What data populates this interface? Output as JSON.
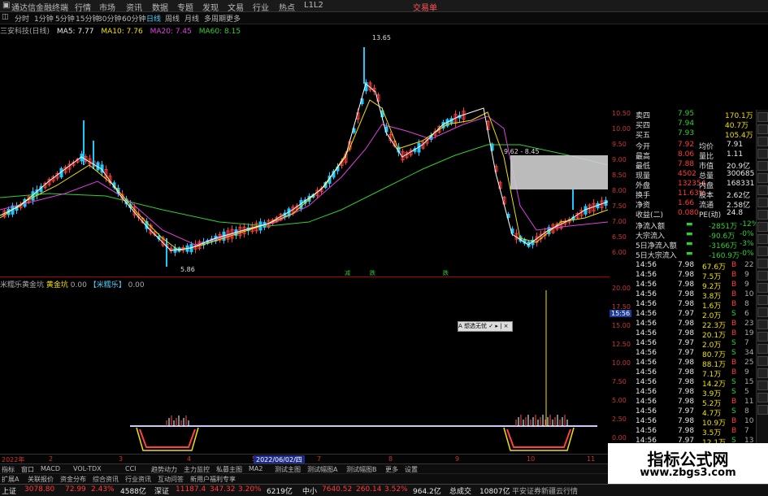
{
  "titlebar": {
    "app_title": "通达信金融终端",
    "menu": [
      "行情",
      "市场",
      "资讯",
      "数据",
      "专题",
      "发现",
      "文易",
      "行业",
      "热点",
      "L1L2"
    ],
    "right_label": "交易单"
  },
  "periodbar": {
    "items": [
      "分时",
      "1分钟",
      "5分钟",
      "15分钟",
      "30分钟",
      "60分钟",
      "日线",
      "周线",
      "月线",
      "多周期",
      "更多"
    ],
    "active": "日线"
  },
  "ma_legend": {
    "stock": "三安科技(日线)",
    "ma5": "MA5: 7.77",
    "ma10": "MA10: 7.76",
    "ma20": "MA20: 7.45",
    "ma60": "MA60: 8.15"
  },
  "colors": {
    "up": "#ff3b3b",
    "down": "#1ec8ff",
    "ma5": "#ffffff",
    "ma10": "#f0e000",
    "ma20": "#e040e0",
    "ma60": "#2fd02f",
    "grid_red": "#a00000"
  },
  "main_annotations": {
    "high": "13.65",
    "low": "5.86",
    "mid_label": "9.62 - 8.45"
  },
  "signal_marks": [
    "减",
    "跌",
    "跌"
  ],
  "indicator_legend": {
    "name": "米糯乐黄金坑",
    "label1": "黄金坑",
    "val1": "0.00",
    "label2": "【米糯乐】",
    "val2": "0.00"
  },
  "right_axis": {
    "price_ticks": [
      "10.50",
      "10.00",
      "9.50",
      "9.00",
      "8.50",
      "8.00",
      "7.50",
      "7.00",
      "6.50",
      "6.00"
    ],
    "ind_ticks": [
      "20.00",
      "17.50",
      "15.00",
      "12.50",
      "10.00",
      "7.50",
      "5.00",
      "2.50",
      "0.00"
    ],
    "time_label": "15:56"
  },
  "quote": {
    "top": [
      {
        "label": "卖四",
        "price": "7.95",
        "vol": "170.1万"
      },
      {
        "label": "买四",
        "price": "7.94",
        "vol": "40.7万"
      },
      {
        "label": "买五",
        "price": "7.93",
        "vol": "105.4万"
      }
    ],
    "stats": [
      {
        "l1": "今开",
        "v1": "7.92",
        "l2": "均价",
        "v2": "7.91"
      },
      {
        "l1": "最高",
        "v1": "8.06",
        "l2": "量比",
        "v2": "1.11"
      },
      {
        "l1": "最低",
        "v1": "7.88",
        "l2": "市值",
        "v2": "20.9亿"
      },
      {
        "l1": "现量",
        "v1": "4502",
        "l2": "总量",
        "v2": "300685"
      },
      {
        "l1": "外盘",
        "v1": "132354",
        "l2": "内盘",
        "v2": "168331"
      },
      {
        "l1": "换手",
        "v1": "11.63%",
        "l2": "股本",
        "v2": "2.62亿"
      },
      {
        "l1": "净资",
        "v1": "1.66",
        "l2": "流通",
        "v2": "2.58亿"
      },
      {
        "l1": "收益(二)",
        "v1": "0.080",
        "l2": "PE(动)",
        "v2": "24.8"
      }
    ],
    "flows": [
      {
        "label": "净流入额",
        "value": "-2851万",
        "pct": "-12%"
      },
      {
        "label": "大宗流入",
        "value": "-90.6万",
        "pct": "-0%"
      },
      {
        "label": "5日净流入额",
        "value": "-3166万",
        "pct": "-3%"
      },
      {
        "label": "5日大宗流入",
        "value": "-160.9万",
        "pct": "-0%"
      }
    ],
    "ticks": [
      {
        "time": "14:56",
        "price": "7.98",
        "vol": "67.6万",
        "bs": "B",
        "n": "22"
      },
      {
        "time": "14:56",
        "price": "7.98",
        "vol": "7.5万",
        "bs": "B",
        "n": "9"
      },
      {
        "time": "14:56",
        "price": "7.98",
        "vol": "9.2万",
        "bs": "B",
        "n": "9"
      },
      {
        "time": "14:56",
        "price": "7.98",
        "vol": "3.8万",
        "bs": "B",
        "n": "10"
      },
      {
        "time": "14:56",
        "price": "7.98",
        "vol": "1.6万",
        "bs": "B",
        "n": "8"
      },
      {
        "time": "14:56",
        "price": "7.97",
        "vol": "2.0万",
        "bs": "S",
        "n": "6"
      },
      {
        "time": "14:56",
        "price": "7.98",
        "vol": "22.3万",
        "bs": "B",
        "n": "23"
      },
      {
        "time": "14:56",
        "price": "7.98",
        "vol": "20.1万",
        "bs": "B",
        "n": "19"
      },
      {
        "time": "14:56",
        "price": "7.97",
        "vol": "2.0万",
        "bs": "S",
        "n": "7"
      },
      {
        "time": "14:56",
        "price": "7.97",
        "vol": "80.7万",
        "bs": "S",
        "n": "34"
      },
      {
        "time": "14:56",
        "price": "7.98",
        "vol": "88.1万",
        "bs": "B",
        "n": "25"
      },
      {
        "time": "14:56",
        "price": "7.98",
        "vol": "7.1万",
        "bs": "B",
        "n": "9"
      },
      {
        "time": "14:56",
        "price": "7.98",
        "vol": "14.2万",
        "bs": "S",
        "n": "15"
      },
      {
        "time": "14:56",
        "price": "7.98",
        "vol": "3.9万",
        "bs": "S",
        "n": "5"
      },
      {
        "time": "14:56",
        "price": "7.98",
        "vol": "5.2万",
        "bs": "B",
        "n": "11"
      },
      {
        "time": "14:56",
        "price": "7.97",
        "vol": "4.7万",
        "bs": "S",
        "n": "8"
      },
      {
        "time": "14:56",
        "price": "7.98",
        "vol": "10.9万",
        "bs": "B",
        "n": "10"
      },
      {
        "time": "14:56",
        "price": "7.98",
        "vol": "3.5万",
        "bs": "B",
        "n": "7"
      },
      {
        "time": "14:56",
        "price": "7.97",
        "vol": "12.1万",
        "bs": "S",
        "n": "13"
      }
    ]
  },
  "xaxis": {
    "labels": [
      "2022年",
      "2",
      "3",
      "4",
      "5",
      "6",
      "7",
      "8",
      "9",
      "10",
      "11"
    ],
    "date_cursor": "2022/06/02/四"
  },
  "tabs_row1": [
    "指标",
    "窗口",
    "MACD",
    "VOL-TDX",
    "CCI",
    "趋势动力",
    "主力监控",
    "私募主图",
    "MA2",
    "测试主图",
    "测试幅图A",
    "测试幅图B",
    "更多",
    "设置"
  ],
  "tabs_row2": [
    "扩展A",
    "关联报价",
    "资金分布",
    "综合资讯",
    "行业资讯",
    "互动问答",
    "新用户福利专享"
  ],
  "popup_text": "A 想选无忧 ✓ ▸ | ×",
  "statusbar": {
    "sh_name": "上证",
    "sh_value": "3078.80",
    "sh_change": "72.99",
    "sh_pct": "2.43%",
    "sh_amount": "4588亿",
    "sz_name": "深证",
    "sz_value": "11187.4",
    "sz_change": "347.32",
    "sz_pct": "3.20%",
    "sz_amount": "6219亿",
    "zx_name": "中小",
    "zx_value": "7640.52",
    "zx_change": "260.14",
    "zx_pct": "3.52%",
    "zx_amount": "964.2亿",
    "total_label": "总成交",
    "total_value": "10807亿",
    "news": "平安证券新疆云行情"
  },
  "watermark": {
    "title": "指标公式网",
    "url": "www.zbgs3.com"
  }
}
